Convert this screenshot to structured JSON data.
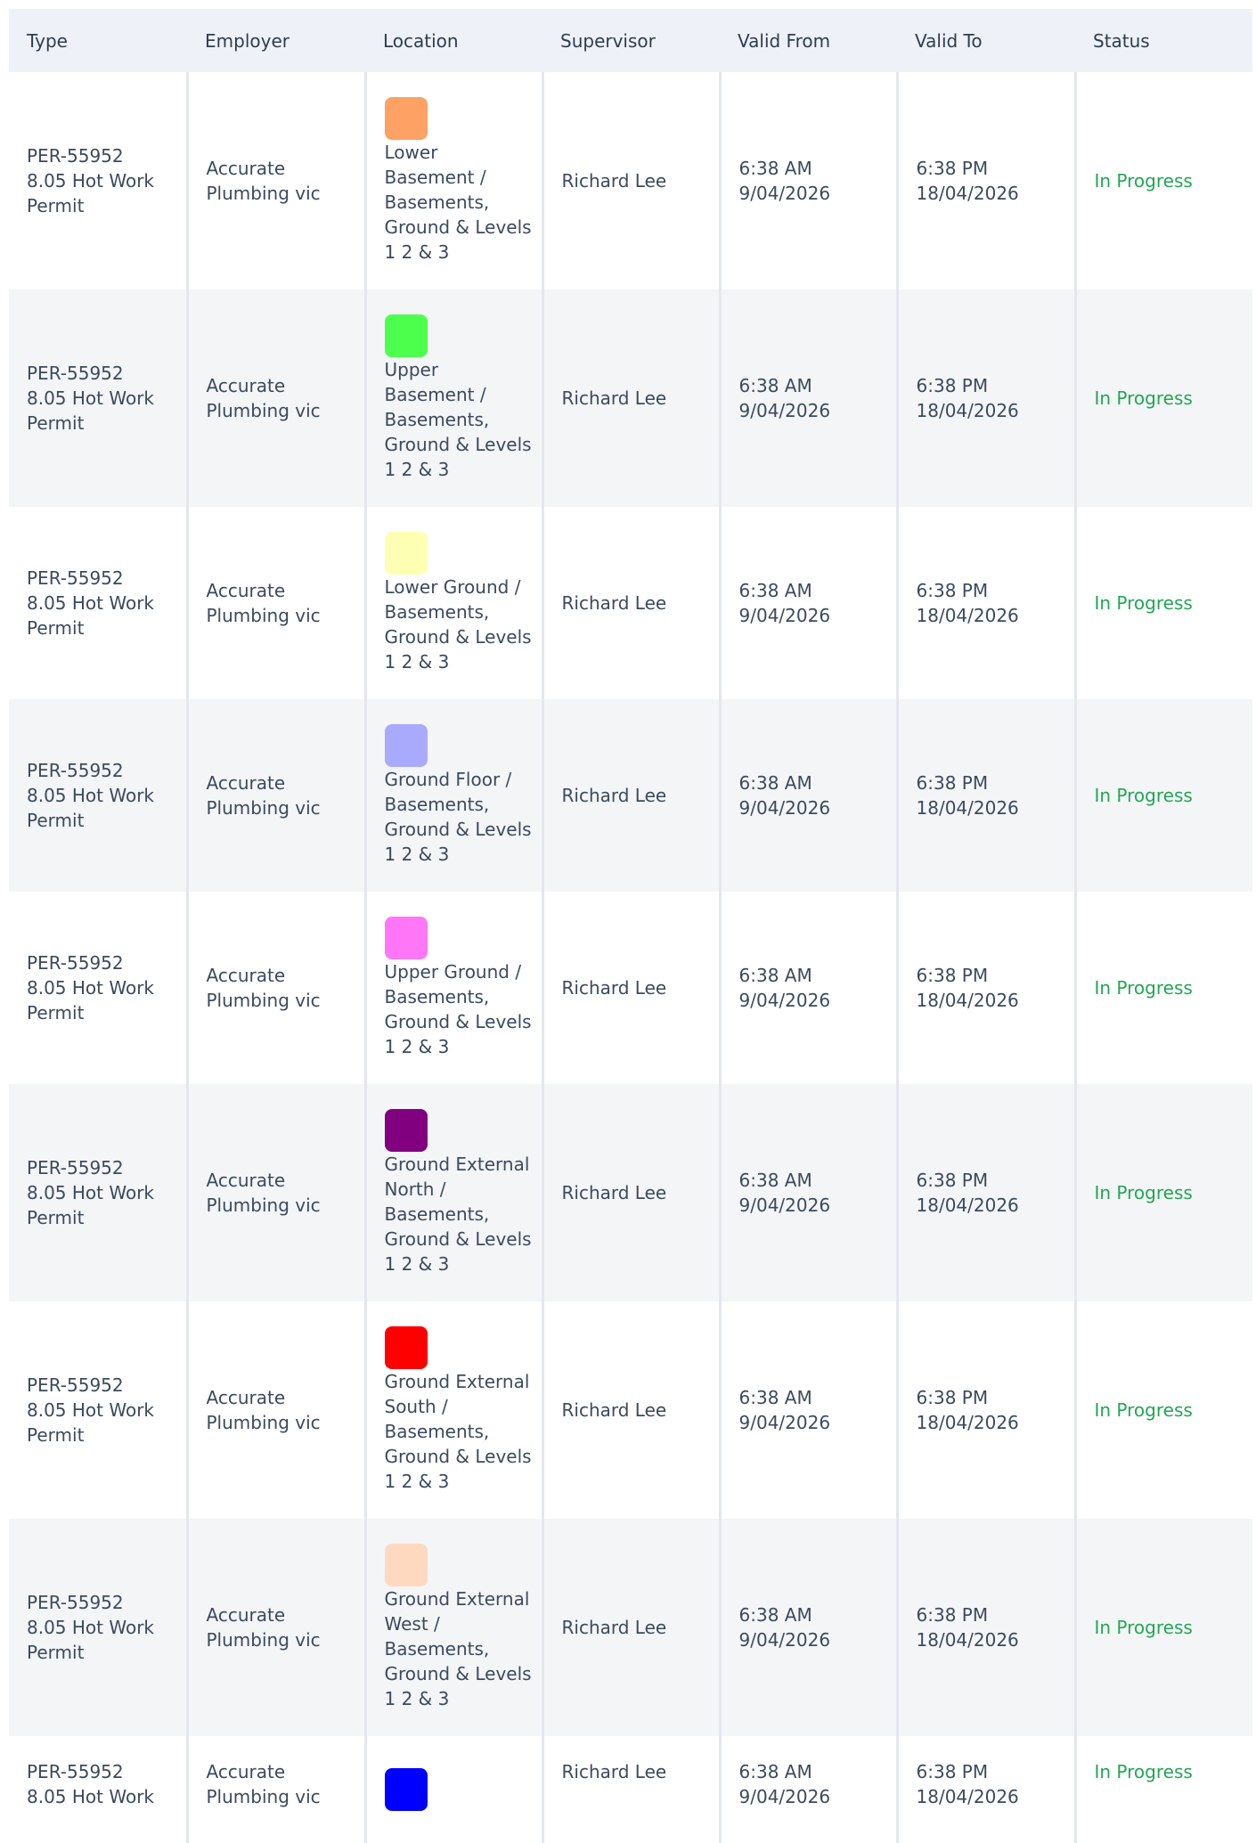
{
  "columns": [
    "Type",
    "Employer",
    "Location",
    "Supervisor",
    "Valid From",
    "Valid To",
    "Status"
  ],
  "rows": [
    {
      "type_id": "PER-55952",
      "type_name": "8.05 Hot Work Permit",
      "employer": "Accurate Plumbing vic",
      "location_color": "#fda165",
      "location": "Lower Basement / Basements, Ground & Levels 1 2 & 3",
      "supervisor": "Richard Lee",
      "from_time": "6:38 AM",
      "from_date": "9/04/2026",
      "to_time": "6:38 PM",
      "to_date": "18/04/2026",
      "status": "In Progress"
    },
    {
      "type_id": "PER-55952",
      "type_name": "8.05 Hot Work Permit",
      "employer": "Accurate Plumbing vic",
      "location_color": "#4dff4d",
      "location": "Upper Basement / Basements, Ground & Levels 1 2 & 3",
      "supervisor": "Richard Lee",
      "from_time": "6:38 AM",
      "from_date": "9/04/2026",
      "to_time": "6:38 PM",
      "to_date": "18/04/2026",
      "status": "In Progress"
    },
    {
      "type_id": "PER-55952",
      "type_name": "8.05 Hot Work Permit",
      "employer": "Accurate Plumbing vic",
      "location_color": "#fdffb3",
      "location": "Lower Ground / Basements, Ground & Levels 1 2 & 3",
      "supervisor": "Richard Lee",
      "from_time": "6:38 AM",
      "from_date": "9/04/2026",
      "to_time": "6:38 PM",
      "to_date": "18/04/2026",
      "status": "In Progress"
    },
    {
      "type_id": "PER-55952",
      "type_name": "8.05 Hot Work Permit",
      "employer": "Accurate Plumbing vic",
      "location_color": "#aaaafd",
      "location": "Ground Floor / Basements, Ground & Levels 1 2 & 3",
      "supervisor": "Richard Lee",
      "from_time": "6:38 AM",
      "from_date": "9/04/2026",
      "to_time": "6:38 PM",
      "to_date": "18/04/2026",
      "status": "In Progress"
    },
    {
      "type_id": "PER-55952",
      "type_name": "8.05 Hot Work Permit",
      "employer": "Accurate Plumbing vic",
      "location_color": "#ff77f6",
      "location": "Upper Ground / Basements, Ground & Levels 1 2 & 3",
      "supervisor": "Richard Lee",
      "from_time": "6:38 AM",
      "from_date": "9/04/2026",
      "to_time": "6:38 PM",
      "to_date": "18/04/2026",
      "status": "In Progress"
    },
    {
      "type_id": "PER-55952",
      "type_name": "8.05 Hot Work Permit",
      "employer": "Accurate Plumbing vic",
      "location_color": "#80007f",
      "location": "Ground External North / Basements, Ground & Levels 1 2 & 3",
      "supervisor": "Richard Lee",
      "from_time": "6:38 AM",
      "from_date": "9/04/2026",
      "to_time": "6:38 PM",
      "to_date": "18/04/2026",
      "status": "In Progress"
    },
    {
      "type_id": "PER-55952",
      "type_name": "8.05 Hot Work Permit",
      "employer": "Accurate Plumbing vic",
      "location_color": "#ff0000",
      "location": "Ground External South / Basements, Ground & Levels 1 2 & 3",
      "supervisor": "Richard Lee",
      "from_time": "6:38 AM",
      "from_date": "9/04/2026",
      "to_time": "6:38 PM",
      "to_date": "18/04/2026",
      "status": "In Progress"
    },
    {
      "type_id": "PER-55952",
      "type_name": "8.05 Hot Work Permit",
      "employer": "Accurate Plumbing vic",
      "location_color": "#fed9c0",
      "location": "Ground External West / Basements, Ground & Levels 1 2 & 3",
      "supervisor": "Richard Lee",
      "from_time": "6:38 AM",
      "from_date": "9/04/2026",
      "to_time": "6:38 PM",
      "to_date": "18/04/2026",
      "status": "In Progress"
    },
    {
      "type_id": "PER-55952",
      "type_name": "8.05 Hot Work",
      "employer": "Accurate Plumbing vic",
      "location_color": "#0000ff",
      "location": "",
      "supervisor": "Richard Lee",
      "from_time": "6:38 AM",
      "from_date": "9/04/2026",
      "to_time": "6:38 PM",
      "to_date": "18/04/2026",
      "status": "In Progress"
    }
  ]
}
